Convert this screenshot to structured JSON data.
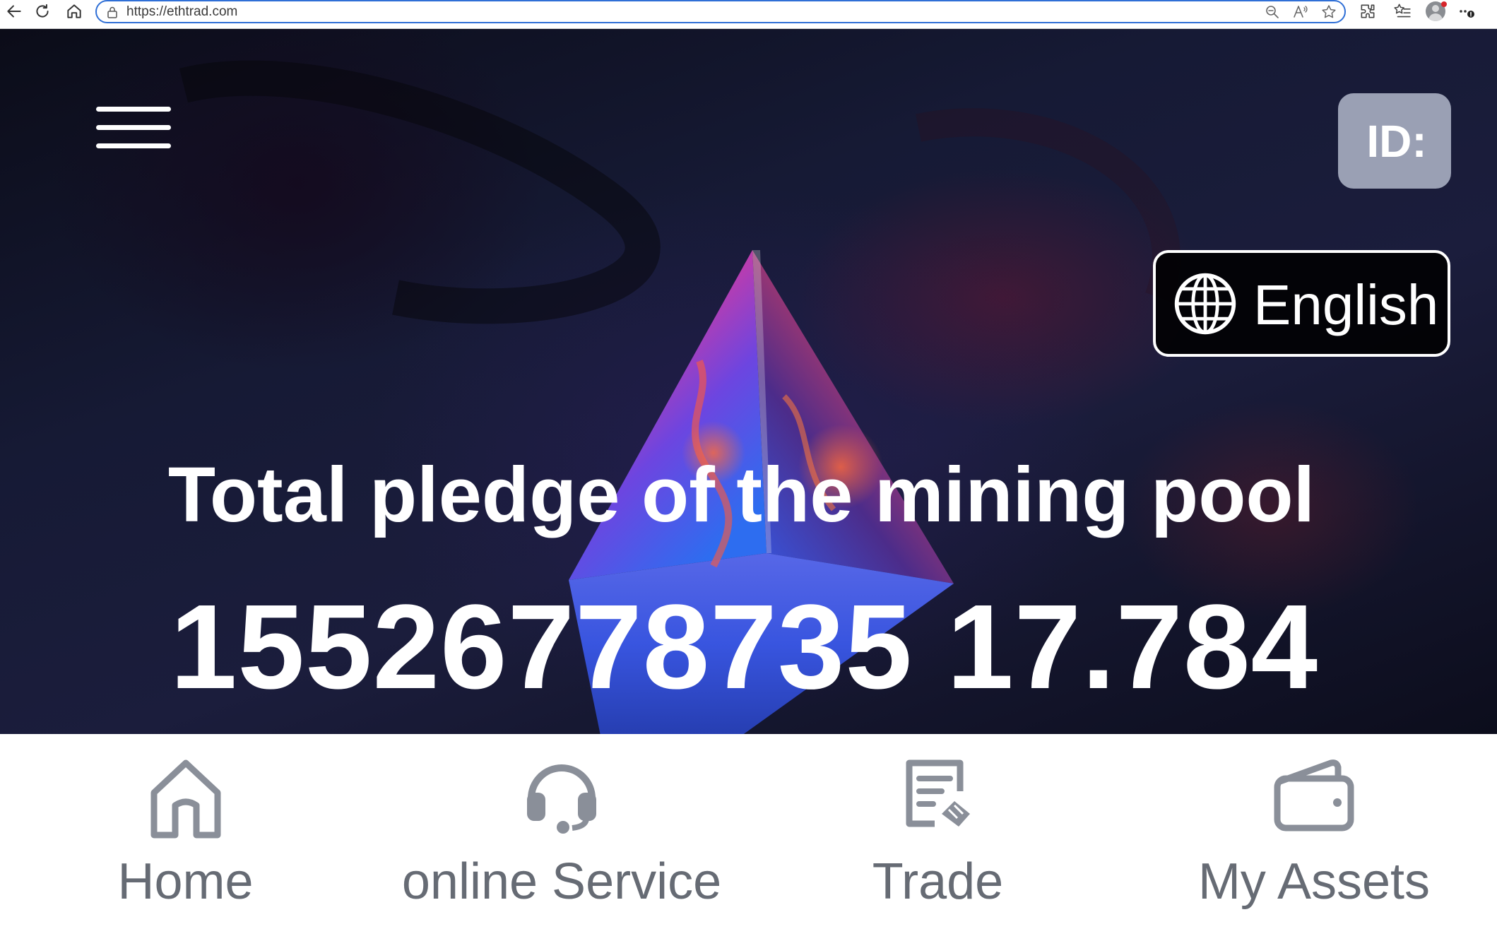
{
  "browser": {
    "url": "https://ethtrad.com"
  },
  "header": {
    "id_label": "ID:",
    "language": "English"
  },
  "hero": {
    "title": "Total pledge of the mining pool",
    "total_pledge": "15526778735 17.784"
  },
  "bottom_nav": {
    "items": [
      {
        "label": "Home",
        "icon": "home-icon"
      },
      {
        "label": "online Service",
        "icon": "headset-icon"
      },
      {
        "label": "Trade",
        "icon": "trade-document-icon"
      },
      {
        "label": "My Assets",
        "icon": "wallet-icon"
      }
    ]
  },
  "colors": {
    "accent_address_border": "#2f6fd6",
    "id_badge": "#9aa0b4",
    "nav_icon": "#8a8f99",
    "nav_label": "#666b74"
  }
}
